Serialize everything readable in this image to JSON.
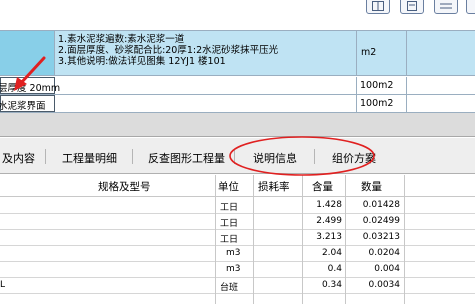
{
  "item_description": {
    "lines": [
      "1.素水泥浆遍数:素水泥浆一道",
      "2.面层厚度、砂浆配合比:20厚1:2水泥砂浆抹平压光",
      "3.其他说明:做法详见图集 12YJ1 楼101"
    ],
    "unit": "m2"
  },
  "sub_rows": [
    {
      "name": "层厚度 20mm",
      "unit": "100m2"
    },
    {
      "name": "水泥浆界面",
      "unit": "100m2"
    }
  ],
  "tabs": [
    {
      "label": "及内容"
    },
    {
      "label": "工程量明细"
    },
    {
      "label": "反查图形工程量"
    },
    {
      "label": "说明信息"
    },
    {
      "label": "组价方案"
    }
  ],
  "resource_table": {
    "headers": {
      "spec": "规格及型号",
      "unit": "单位",
      "loss": "损耗率",
      "content": "含量",
      "qty": "数量"
    },
    "rows": [
      {
        "name": "",
        "unit": "工日",
        "content": "1.428",
        "qty": "0.01428"
      },
      {
        "name": "",
        "unit": "工日",
        "content": "2.499",
        "qty": "0.02499"
      },
      {
        "name": "",
        "unit": "工日",
        "content": "3.213",
        "qty": "0.03213"
      },
      {
        "name": "",
        "unit": "m3",
        "content": "2.04",
        "qty": "0.0204"
      },
      {
        "name": "",
        "unit": "m3",
        "content": "0.4",
        "qty": "0.004"
      },
      {
        "name": "L",
        "unit": "台班",
        "content": "0.34",
        "qty": "0.0034"
      }
    ]
  },
  "colors": {
    "selected_row": "#bfe3f3",
    "annotation_red": "#e02020"
  }
}
